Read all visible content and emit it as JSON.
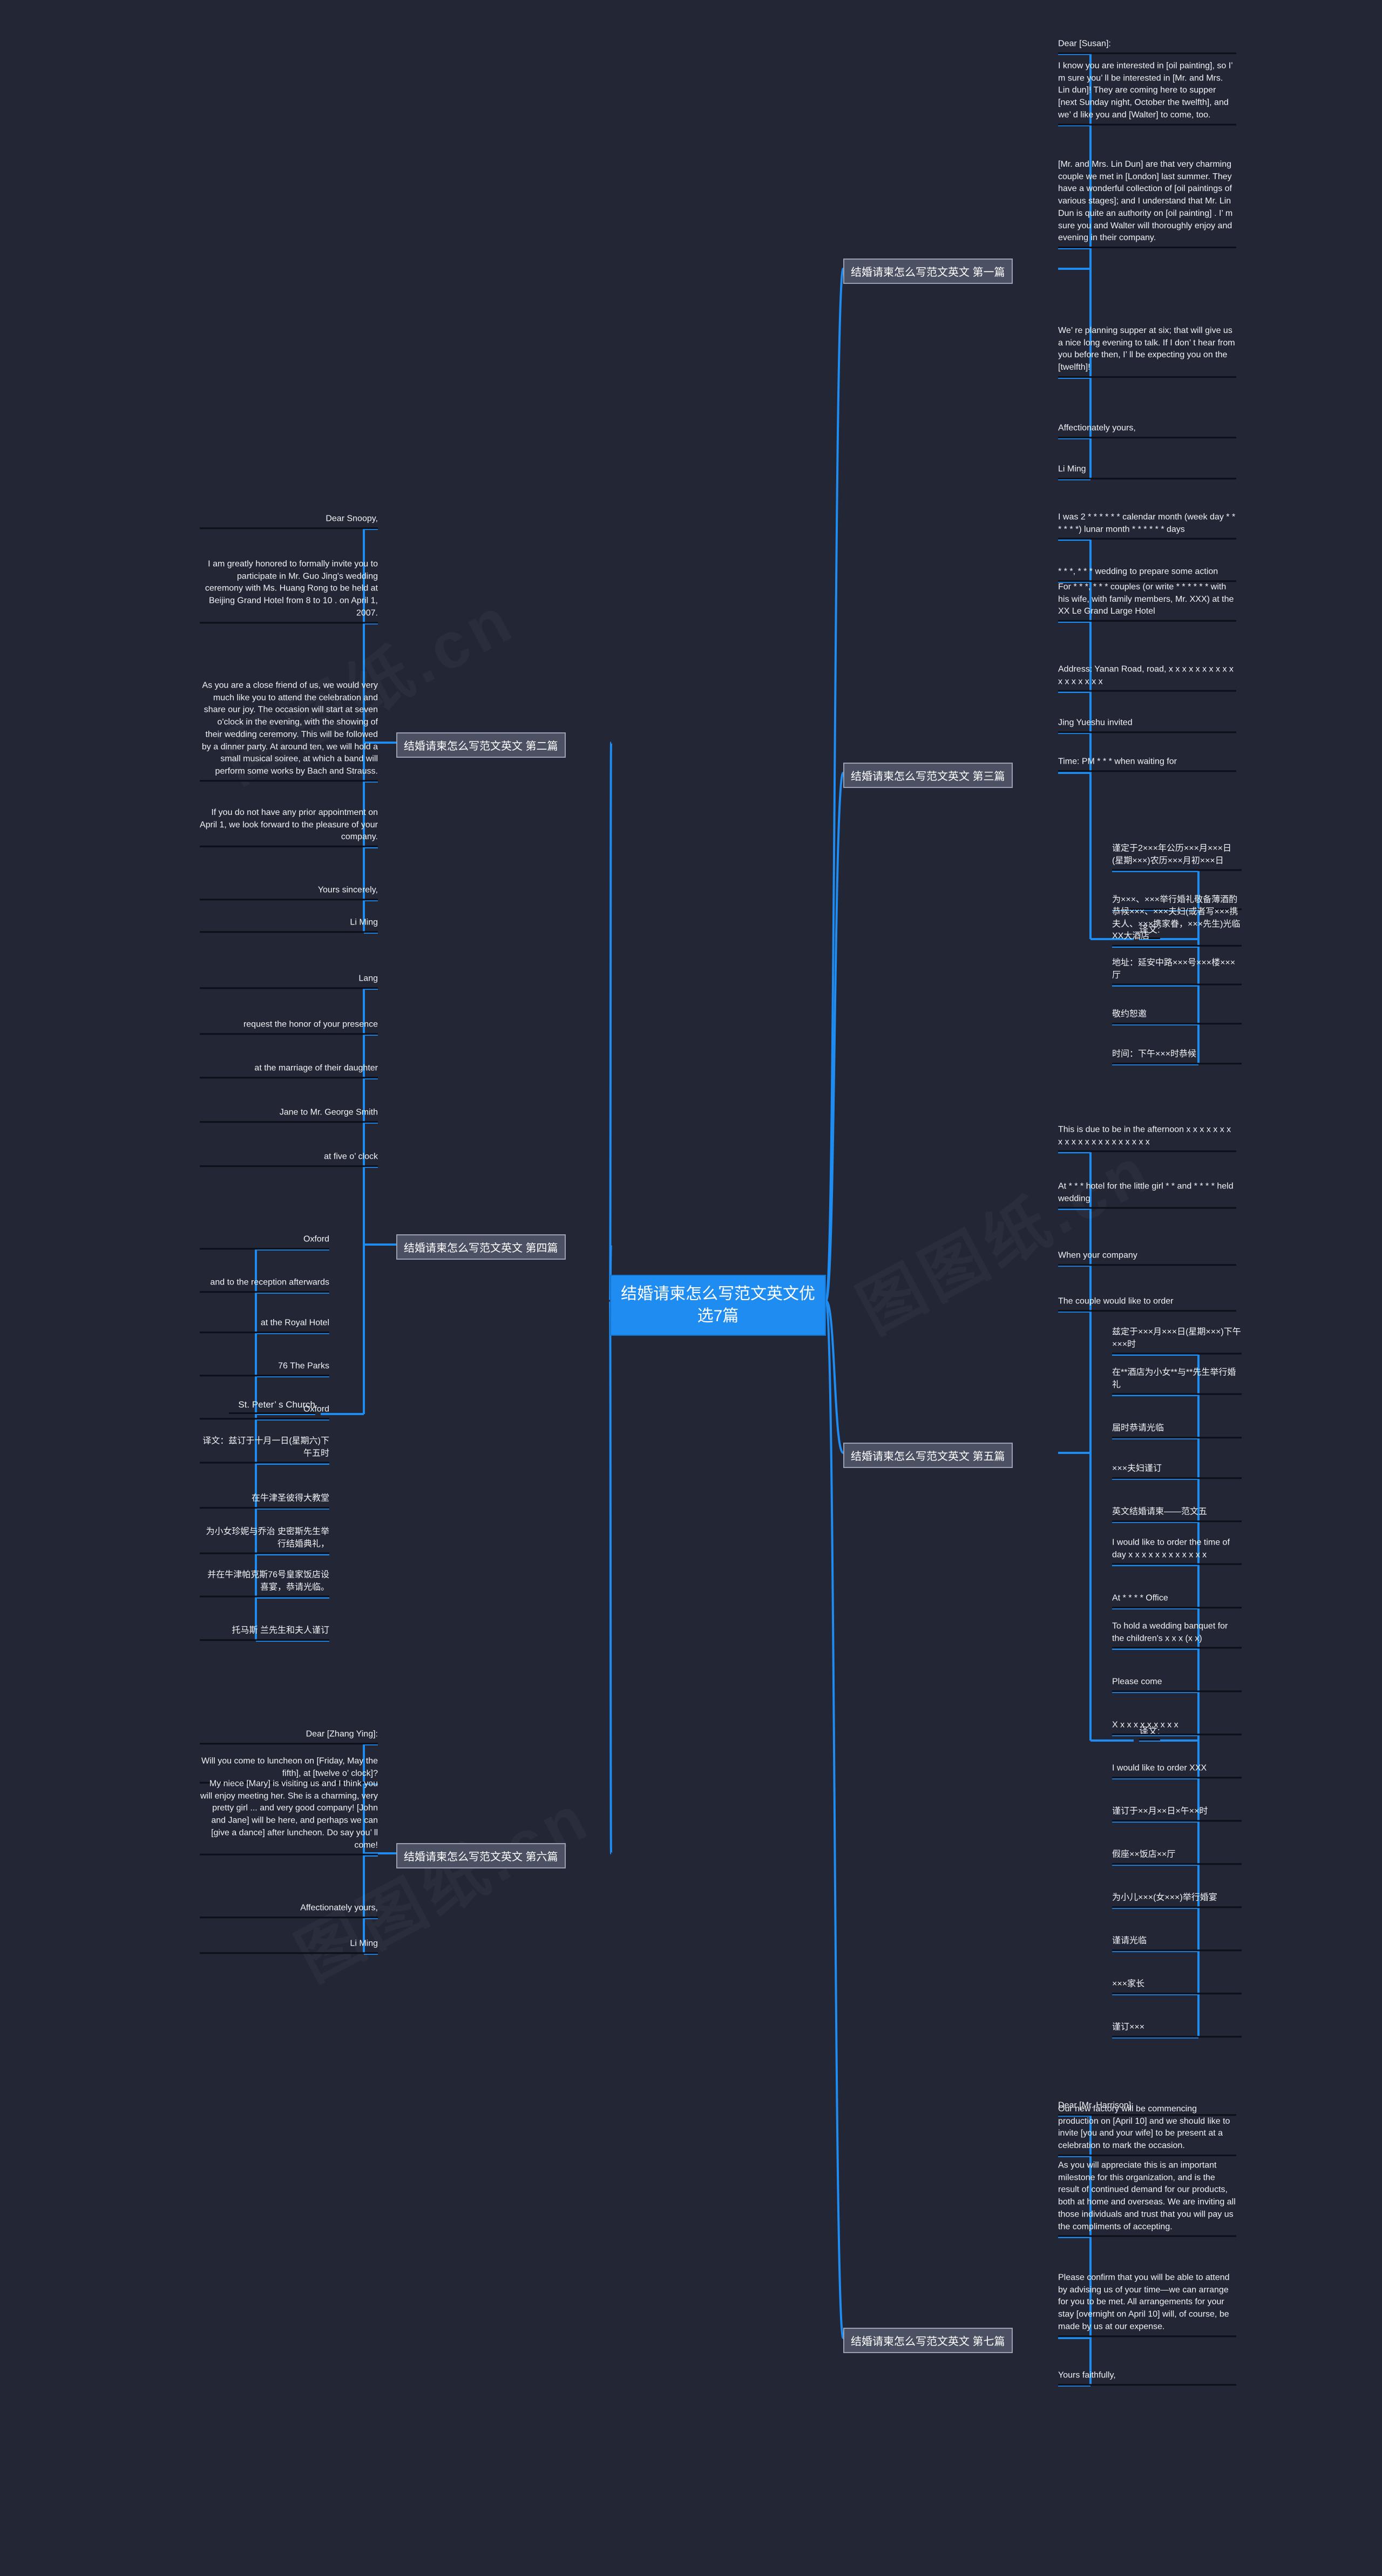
{
  "root": {
    "title": "结婚请柬怎么写范文英文优选7篇"
  },
  "colors": {
    "accent": "#1f8cf2",
    "background": "#222635",
    "branch_fill": "#4b5063",
    "underline": "#0c0f18"
  },
  "watermarks": [
    "图图纸.cn",
    "图图纸.cn",
    "图图纸.cn"
  ],
  "branches": [
    {
      "label": "结婚请柬怎么写范文英文 第一篇",
      "side": "right",
      "leaves": [
        "Dear [Susan]:",
        "I know you are interested in [oil painting], so I’ m sure you’ ll be interested in [Mr. and Mrs. Lin dun]! They are coming here to supper [next Sunday night, October the twelfth], and we’ d like you and [Walter] to come, too.",
        "[Mr. and Mrs. Lin Dun] are that very charming couple we met in [London] last summer. They have a wonderful collection of [oil paintings of various stages]; and I understand that Mr. Lin Dun is quite an authority on [oil painting] . I’ m sure you and Walter will thoroughly enjoy and evening in their company.",
        "We’ re planning supper at six; that will give us a nice long evening to talk. If I don’ t hear from you before then, I’ ll be expecting you on the [twelfth]!",
        "Affectionately yours,",
        "Li Ming"
      ]
    },
    {
      "label": "结婚请柬怎么写范文英文 第二篇",
      "side": "left",
      "leaves": [
        "Dear Snoopy,",
        "I am greatly honored to formally invite you to participate in Mr. Guo Jing's wedding ceremony with Ms. Huang Rong to be held at Beijing Grand Hotel from 8 to 10 . on April 1, 2007.",
        "As you are a close friend of us, we would very much like you to attend the celebration and share our joy. The occasion will start at seven o'clock in the evening, with the showing of their wedding ceremony. This will be followed by a dinner party. At around ten, we will hold a small musical soiree, at which a band will perform some works by Bach and Strauss.",
        "If you do not have any prior appointment on April 1, we look forward to the pleasure of your company.",
        "Yours sincerely,",
        "Li Ming"
      ]
    },
    {
      "label": "结婚请柬怎么写范文英文 第三篇",
      "side": "right",
      "leaves": [
        "I was 2 * * * * * * calendar month (week day * * * * * *) lunar month * * * * * * days",
        "* * *, * * * wedding to prepare some action",
        "For * * *, * * * couples (or write * * * * * * with his wife, with family members, Mr. XXX) at the XX Le Grand Large Hotel",
        "Address: Yanan Road, road, x x x x x x x x x x x x x x x x x",
        "Jing Yueshu invited",
        "Time: PM * * * when waiting for"
      ],
      "sub": {
        "label": "译文:",
        "leaves": [
          "谨定于2×××年公历×××月×××日(星期×××)农历×××月初×××日",
          "为×××、×××举行婚礼敬备薄酒酌",
          "恭候×××、×××夫妇(或者写×××携夫人、×××携家眷，×××先生)光临XX大酒店",
          "地址：延安中路×××号×××楼×××厅",
          "敬约恕邀",
          "时间：下午×××时恭候"
        ]
      }
    },
    {
      "label": "结婚请柬怎么写范文英文 第四篇",
      "side": "left",
      "leaves": [
        "Lang",
        "request the honor of your presence",
        "at the marriage of their daughter",
        "Jane to Mr. George Smith",
        "at five o’ clock"
      ],
      "sub": {
        "label": "St. Peter’ s Church",
        "leaves": [
          "Oxford",
          "and to the reception afterwards",
          "at the Royal Hotel",
          "76 The Parks",
          "Oxford",
          "译文：兹订于十月一日(星期六)下午五时",
          "在牛津圣彼得大教堂",
          "为小女珍妮与乔治 史密斯先生举行结婚典礼，",
          "并在牛津帕克斯76号皇家饭店设喜宴，恭请光临。",
          "托马斯 兰先生和夫人谨订"
        ]
      }
    },
    {
      "label": "结婚请柬怎么写范文英文 第五篇",
      "side": "right",
      "leaves": [
        "This is due to be in the afternoon x x x x x x x x x x x x x x x x x x x x x",
        "At * * * hotel for the little girl * * and * * * * held wedding",
        "When your company",
        "The couple would like to order"
      ],
      "sub": {
        "label": "译文:",
        "leaves": [
          "兹定于×××月×××日(星期×××)下午×××时",
          "在**酒店为小女**与**先生举行婚礼",
          "届时恭请光临",
          "×××夫妇谨订",
          "英文结婚请柬——范文五",
          "I would like to order the time of day x x x x x x x x x x x x",
          "At * * * * Office",
          "To hold a wedding banquet for the children's x x x (x x)",
          "Please come",
          "X x x x x x x x x x",
          "I would like to order XXX",
          "谨订于××月××日×午××时",
          "假座××饭店××厅",
          "为小儿×××(女×××)举行婚宴",
          "谨请光临",
          "×××家长",
          "谨订×××"
        ]
      }
    },
    {
      "label": "结婚请柬怎么写范文英文 第六篇",
      "side": "left",
      "leaves": [
        "Dear [Zhang Ying]:",
        "Will you come to luncheon on [Friday, May the fifth], at [twelve o’ clock]?",
        "My niece [Mary] is visiting us and I think you will enjoy meeting her. She is a charming, very pretty girl ... and very good company! [John and Jane] will be here, and perhaps we can [give a dance] after luncheon. Do say you’ ll come!",
        "Affectionately yours,",
        "Li Ming"
      ]
    },
    {
      "label": "结婚请柬怎么写范文英文 第七篇",
      "side": "right",
      "leaves": [
        "Dear [Mr. Harrison]:",
        "Our new factory will be commencing production on [April 10] and we should like to invite [you and your wife] to be present at a celebration to mark the occasion.",
        "As you will appreciate this is an important milestone for this organization, and is the result of continued demand for our products, both at home and overseas. We are inviting all those individuals and trust that you will pay us the compliments of accepting.",
        "Please confirm that you will be able to attend by advising us of your time—we can arrange for you to be met. All arrangements for your stay [overnight on April 10] will, of course, be made by us at our expense.",
        "Yours faithfully,"
      ]
    }
  ]
}
